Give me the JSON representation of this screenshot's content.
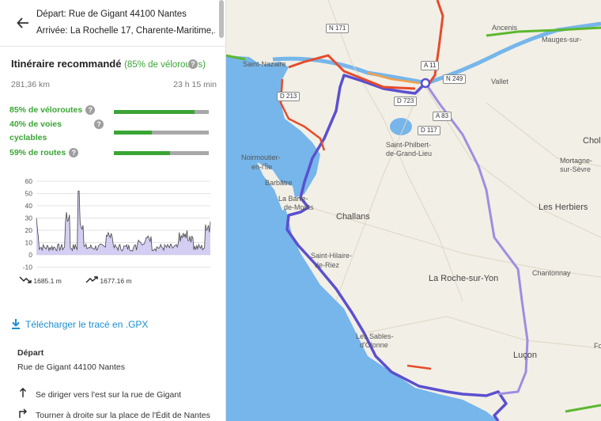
{
  "route": {
    "departure": "Départ: Rue de Gigant 44100 Nantes",
    "arrival": "Arrivée: La Rochelle 17, Charente-Maritime,..."
  },
  "summary": {
    "title": "Itinéraire recommandé",
    "percent_label": "(85% de véloroutes)",
    "distance": "281,36 km",
    "duration": "23 h 15 min"
  },
  "stats": [
    {
      "label": "85% de véloroutes",
      "fraction": 0.85
    },
    {
      "label_line1": "40% de voies",
      "label_line2": "cyclables",
      "fraction": 0.4
    },
    {
      "label": "59% de routes",
      "fraction": 0.59
    }
  ],
  "elevation": {
    "y_ticks": [
      "60",
      "50",
      "40",
      "30",
      "20",
      "10",
      "0",
      "-10"
    ],
    "descent": "1685.1 m",
    "ascent": "1677.16 m"
  },
  "gpx_label": "Télécharger le tracé en .GPX",
  "itinerary": {
    "start_label": "Départ",
    "start_address": "Rue de Gigant 44100 Nantes",
    "steps": [
      {
        "text": "Se diriger vers l'est sur la rue de Gigant",
        "icon": "arrow-up-icon"
      },
      {
        "text": "Tourner à droite sur la place de l'Édit de Nantes",
        "icon": "turn-right-icon"
      }
    ]
  },
  "map": {
    "places": [
      "Saint-Nazaire",
      "Ancenis",
      "Mauges-sur-",
      "Vallet",
      "Saint-Philbert-",
      "de-Grand-Lieu",
      "Noirmoutier-",
      "en-l'Île",
      "Barbâtre",
      "La Barre-",
      "de-Monts",
      "Challans",
      "Cholet",
      "Mortagne-",
      "sur-Sèvre",
      "Les Herbiers",
      "Saint-Hilaire-",
      "de-Riez",
      "La Roche-sur-Yon",
      "Chantonnay",
      "Les Sables-",
      "d'Olonne",
      "Luçon",
      "Fo"
    ],
    "roads": [
      "N 171",
      "A 11",
      "N 249",
      "D 213",
      "D 723",
      "A 83",
      "D 117"
    ],
    "colors": {
      "sea": "#76b6ea",
      "land": "#f2efe6",
      "route_main": "#5b4fcf",
      "cycle_green": "#5cb82e",
      "road_red": "#e64b2b",
      "orange": "#f2a04a"
    }
  }
}
